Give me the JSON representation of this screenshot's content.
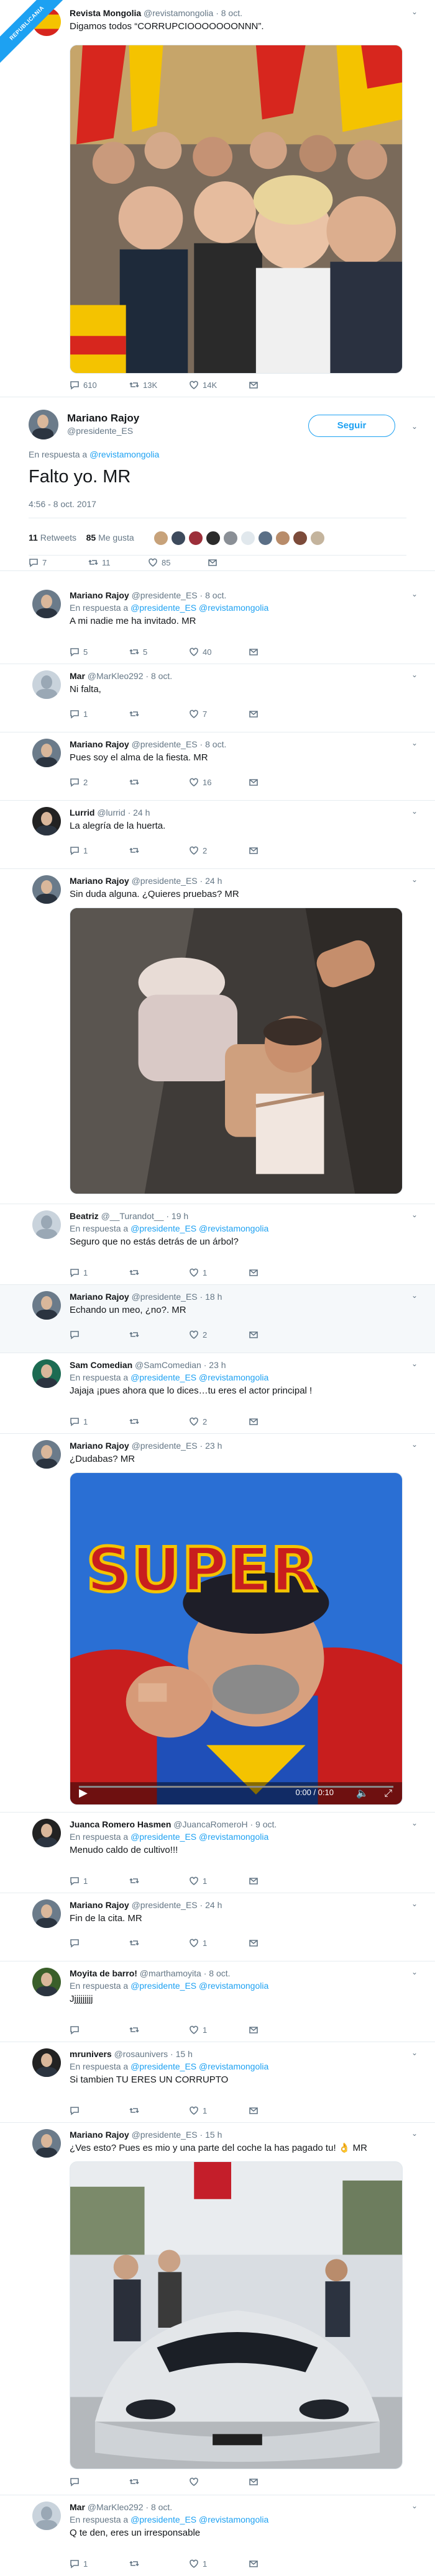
{
  "badge": "REPUBLICANIA",
  "quoted": {
    "name": "Revista Mongolia",
    "handle": "@revistamongolia",
    "date": "8 oct.",
    "text": "Digamos todos “CORRUPCIOOOOOOONNN”.",
    "replies": "610",
    "retweets": "13K",
    "likes": "14K"
  },
  "main": {
    "name": "Mariano Rajoy",
    "handle": "@presidente_ES",
    "follow": "Seguir",
    "reply_prefix": "En respuesta a",
    "reply_to": "@revistamongolia",
    "text": "Falto yo. MR",
    "timestamp": "4:56 - 8 oct. 2017",
    "retweets_count": "11",
    "retweets_label": "Retweets",
    "likes_count": "85",
    "likes_label": "Me gusta",
    "replies": "7",
    "rts": "11",
    "favs": "85"
  },
  "replies": [
    {
      "name": "Mariano Rajoy",
      "handle": "@presidente_ES",
      "date": "8 oct.",
      "reply_to": "@revistamongolia",
      "text": "A mi nadie me ha invitado. MR",
      "r": "5",
      "rt": "5",
      "l": "40"
    },
    {
      "name": "Mar",
      "handle": "@MarKleo292",
      "date": "8 oct.",
      "reply_to": "",
      "text": "Ni falta,",
      "r": "1",
      "rt": "",
      "l": "7"
    },
    {
      "name": "Mariano Rajoy",
      "handle": "@presidente_ES",
      "date": "8 oct.",
      "reply_to": "",
      "text": "Pues soy el alma de la fiesta. MR",
      "r": "2",
      "rt": "",
      "l": "16"
    },
    {
      "name": "Lurrid",
      "handle": "@lurrid",
      "date": "24 h",
      "reply_to": "",
      "text": "La alegría de la huerta.",
      "r": "1",
      "rt": "",
      "l": "2"
    },
    {
      "name": "Mariano Rajoy",
      "handle": "@presidente_ES",
      "date": "24 h",
      "reply_to": "",
      "text": "Sin duda alguna. ¿Quieres pruebas? MR",
      "r": "",
      "rt": "",
      "l": ""
    },
    {
      "name": "Beatriz",
      "handle": "@__Turandot__",
      "date": "19 h",
      "reply_to": "@presidente_ES @revistamongolia",
      "text": "Seguro que no estás detrás de un árbol?",
      "r": "1",
      "rt": "",
      "l": "1"
    },
    {
      "name": "Mariano Rajoy",
      "handle": "@presidente_ES",
      "date": "18 h",
      "reply_to": "",
      "text": "Echando un meo, ¿no?. MR",
      "r": "",
      "rt": "",
      "l": "2"
    },
    {
      "name": "Sam Comedian",
      "handle": "@SamComedian",
      "date": "23 h",
      "reply_to": "@presidente_ES @revistamongolia",
      "text": "Jajaja ¡pues ahora que lo dices…tu eres el actor principal !",
      "r": "1",
      "rt": "",
      "l": "2"
    },
    {
      "name": "Mariano Rajoy",
      "handle": "@presidente_ES",
      "date": "23 h",
      "reply_to": "",
      "text": "¿Dudabas? MR",
      "r": "",
      "rt": "",
      "l": ""
    },
    {
      "name": "Juanca Romero Hasmen",
      "handle": "@JuancaRomeroH",
      "date": "9 oct.",
      "reply_to": "@presidente_ES @revistamongolia",
      "text": "Menudo caldo de cultivo!!!",
      "r": "1",
      "rt": "",
      "l": "1"
    },
    {
      "name": "Mariano Rajoy",
      "handle": "@presidente_ES",
      "date": "24 h",
      "reply_to": "",
      "text": "Fin de la cita. MR",
      "r": "",
      "rt": "",
      "l": "1"
    },
    {
      "name": "Moyita de barro!",
      "handle": "@marthamoyita",
      "date": "8 oct.",
      "reply_to": "@presidente_ES @revistamongolia",
      "text": "Jjjjjjjjjj",
      "r": "",
      "rt": "",
      "l": "1"
    },
    {
      "name": "mrunivers",
      "handle": "@rosaunivers",
      "date": "15 h",
      "reply_to": "@presidente_ES @revistamongolia",
      "text": "Si tambien TU ERES UN CORRUPTO",
      "r": "",
      "rt": "",
      "l": "1"
    },
    {
      "name": "Mariano Rajoy",
      "handle": "@presidente_ES",
      "date": "15 h",
      "reply_to": "",
      "text": "¿Ves esto? Pues es mio y una parte del coche la has pagado tu! 👌 MR",
      "r": "",
      "rt": "",
      "l": ""
    },
    {
      "name": "Mar",
      "handle": "@MarKleo292",
      "date": "8 oct.",
      "reply_to": "@presidente_ES @revistamongolia",
      "text": "Q te den, eres un irresponsable",
      "r": "1",
      "rt": "",
      "l": "1"
    }
  ],
  "video": {
    "time": "0:00 / 0:10",
    "title": "SUPER"
  },
  "icons": {
    "reply": "reply-icon",
    "retweet": "retweet-icon",
    "like": "heart-icon",
    "dm": "envelope-icon",
    "more": "chevron-down-icon"
  },
  "colors": {
    "accent": "#1da1f2",
    "text": "#14171a",
    "muted": "#657786",
    "border": "#e6ecf0"
  }
}
